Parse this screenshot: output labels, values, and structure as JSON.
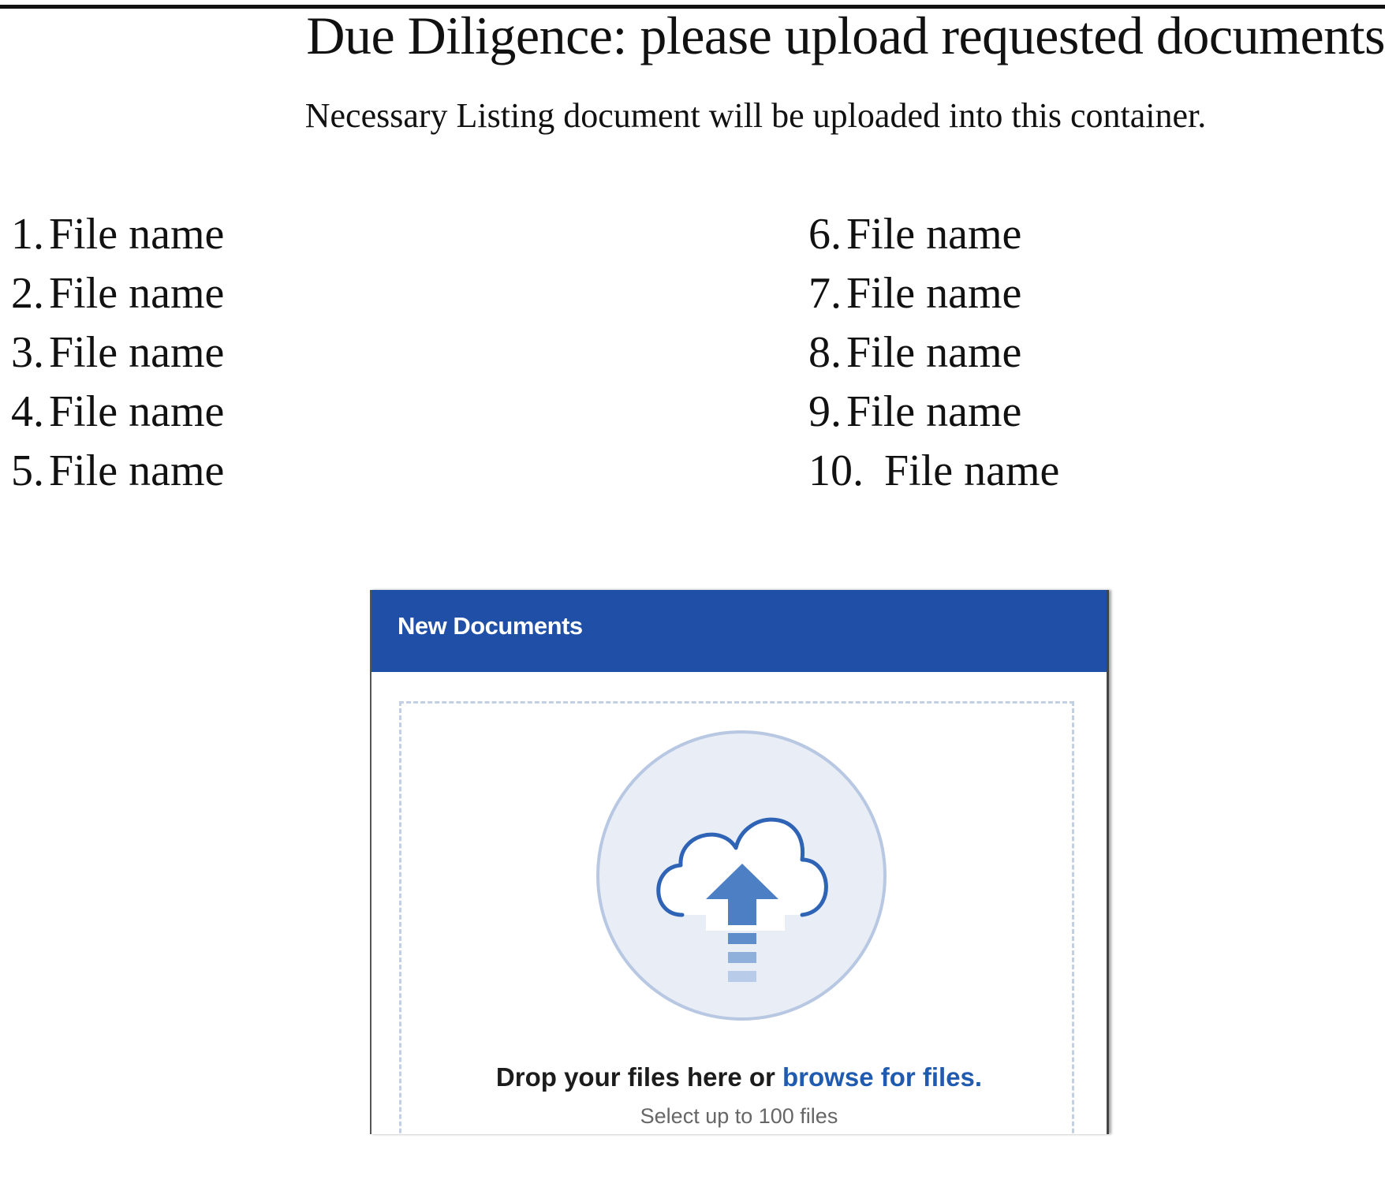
{
  "header": {
    "title": "Due Diligence: please upload requested documents",
    "subtitle": "Necessary Listing document will be uploaded into this container."
  },
  "files": {
    "left": [
      {
        "number": "1.",
        "name": "File name"
      },
      {
        "number": "2.",
        "name": "File name"
      },
      {
        "number": "3.",
        "name": "File name"
      },
      {
        "number": "4.",
        "name": "File name"
      },
      {
        "number": "5.",
        "name": "File name"
      }
    ],
    "right": [
      {
        "number": "6.",
        "name": "File name"
      },
      {
        "number": "7.",
        "name": "File name"
      },
      {
        "number": "8.",
        "name": "File name"
      },
      {
        "number": "9.",
        "name": "File name"
      },
      {
        "number": "10.",
        "name": "File name"
      }
    ]
  },
  "upload_panel": {
    "title": "New Documents",
    "drop_text": "Drop your files here or ",
    "browse_link": "browse for files.",
    "hint": "Select up to 100 files",
    "icon": "cloud-upload-icon"
  },
  "colors": {
    "header_blue": "#1f4fa6",
    "link_blue": "#1f5bb0",
    "circle_fill": "#e8edf6",
    "circle_stroke": "#b9c8e2",
    "arrow_blue": "#4d7fc4"
  }
}
